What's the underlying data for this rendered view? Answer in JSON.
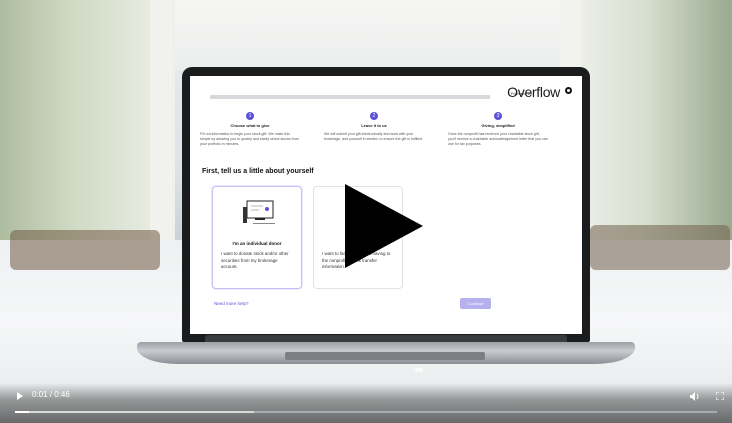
{
  "screen": {
    "brand": {
      "powered_by": "Powered by",
      "name": "Overflow"
    },
    "steps": [
      {
        "number": "1",
        "title": "Choose what to give",
        "desc": "Fill out information to begin your stock gift. We make this simple by allowing you to quickly and easily select stocks from your portfolio in minutes."
      },
      {
        "number": "2",
        "title": "Leave it to us",
        "desc": "We will submit your gift electronically and work with your brokerage, and yourself if needed, to ensure the gift is fulfilled."
      },
      {
        "number": "3",
        "title": "Giving, simplified",
        "desc": "Once the nonprofit has received your charitable stock gift, you'll receive a charitable acknowledgement letter that you can use for tax purposes."
      }
    ],
    "section_title": "First, tell us a little about yourself",
    "cards": [
      {
        "title": "I'm an individual donor",
        "body": "I want to donate stock and/or other securities from my brokerage account."
      },
      {
        "title": "I'm a f",
        "body": "I want to facili          time by not having to              the nonprofit's stock transfer information."
      }
    ],
    "help_link": "Need more help?",
    "continue_button": "Continue"
  },
  "player": {
    "time": "0:01 / 0:46",
    "progress_fraction": 0.02,
    "buffered_fraction": 0.34
  },
  "colors": {
    "accent": "#5b50d6",
    "button_disabled": "#b6b0ee"
  }
}
